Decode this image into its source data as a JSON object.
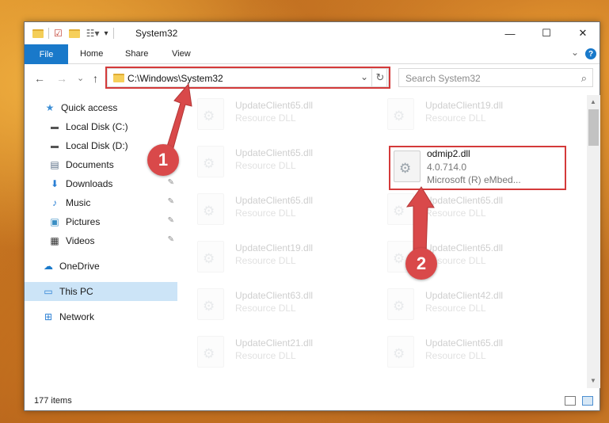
{
  "window": {
    "title": "System32",
    "controls": {
      "minimize": "—",
      "maximize": "☐",
      "close": "✕"
    }
  },
  "ribbon": {
    "tabs": [
      "File",
      "Home",
      "Share",
      "View"
    ],
    "expand": "⌄",
    "help": "?"
  },
  "nav": {
    "back": "←",
    "forward": "→",
    "recent": "⌄",
    "up": "↑",
    "address": "C:\\Windows\\System32",
    "address_chevron": "⌄",
    "refresh": "↻",
    "search_placeholder": "Search System32",
    "search_icon": "🔍"
  },
  "sidebar": {
    "items": [
      {
        "label": "Quick access",
        "icon": "★",
        "icon_name": "star-icon",
        "pinned": false
      },
      {
        "label": "Local Disk (C:)",
        "icon": "▬",
        "icon_name": "drive-icon",
        "pinned": false
      },
      {
        "label": "Local Disk (D:)",
        "icon": "▬",
        "icon_name": "drive-icon",
        "pinned": false
      },
      {
        "label": "Documents",
        "icon": "▤",
        "icon_name": "document-icon",
        "pinned": false
      },
      {
        "label": "Downloads",
        "icon": "⬇",
        "icon_name": "download-icon",
        "pinned": true
      },
      {
        "label": "Music",
        "icon": "♪",
        "icon_name": "music-icon",
        "pinned": true
      },
      {
        "label": "Pictures",
        "icon": "▣",
        "icon_name": "pictures-icon",
        "pinned": true
      },
      {
        "label": "Videos",
        "icon": "▦",
        "icon_name": "video-icon",
        "pinned": true
      },
      {
        "label": "OneDrive",
        "icon": "☁",
        "icon_name": "cloud-icon",
        "pinned": false
      },
      {
        "label": "This PC",
        "icon": "▭",
        "icon_name": "computer-icon",
        "pinned": false,
        "selected": true
      },
      {
        "label": "Network",
        "icon": "⊞",
        "icon_name": "network-icon",
        "pinned": false
      }
    ],
    "pin_glyph": "📌"
  },
  "files": [
    {
      "name": "UpdateClient65.dll",
      "type": "Resource DLL"
    },
    {
      "name": "UpdateClient19.dll",
      "type": "Resource DLL"
    },
    {
      "name": "UpdateClient65.dll",
      "type": "Resource DLL"
    },
    {
      "name": "odmip2.dll",
      "type": "4.0.714.0",
      "sub": "Microsoft (R) eMbed..."
    },
    {
      "name": "UpdateClient65.dll",
      "type": "Resource DLL"
    },
    {
      "name": "UpdateClient65.dll",
      "type": "Resource DLL"
    },
    {
      "name": "UpdateClient19.dll",
      "type": "Resource DLL"
    },
    {
      "name": "UpdateClient65.dll",
      "type": "Resource DLL"
    },
    {
      "name": "UpdateClient63.dll",
      "type": "Resource DLL"
    },
    {
      "name": "UpdateClient42.dll",
      "type": "Resource DLL"
    },
    {
      "name": "UpdateClient21.dll",
      "type": "Resource DLL"
    },
    {
      "name": "UpdateClient65.dll",
      "type": "Resource DLL"
    }
  ],
  "status": {
    "items": "177 items"
  },
  "annotations": {
    "step1": "1",
    "step2": "2"
  },
  "colors": {
    "accent": "#1979ca",
    "highlight": "#d43a3a",
    "selected": "#cce4f7"
  }
}
